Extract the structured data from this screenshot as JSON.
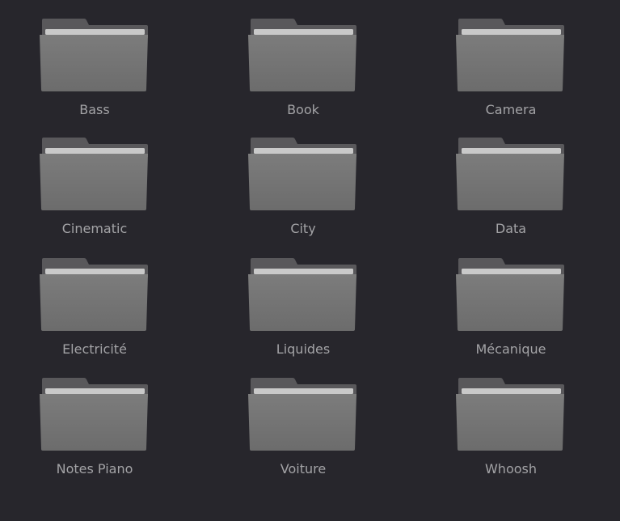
{
  "folders": [
    {
      "name": "Bass"
    },
    {
      "name": "Book"
    },
    {
      "name": "Camera"
    },
    {
      "name": "Cinematic"
    },
    {
      "name": "City"
    },
    {
      "name": "Data"
    },
    {
      "name": "Electricité"
    },
    {
      "name": "Liquides"
    },
    {
      "name": "Mécanique"
    },
    {
      "name": "Notes Piano"
    },
    {
      "name": "Voiture"
    },
    {
      "name": "Whoosh"
    }
  ],
  "colors": {
    "background": "#27262c",
    "folder_back": "#59585b",
    "folder_front": "#767676",
    "paper": "#c8c8c8",
    "label": "#a3a3a6"
  }
}
